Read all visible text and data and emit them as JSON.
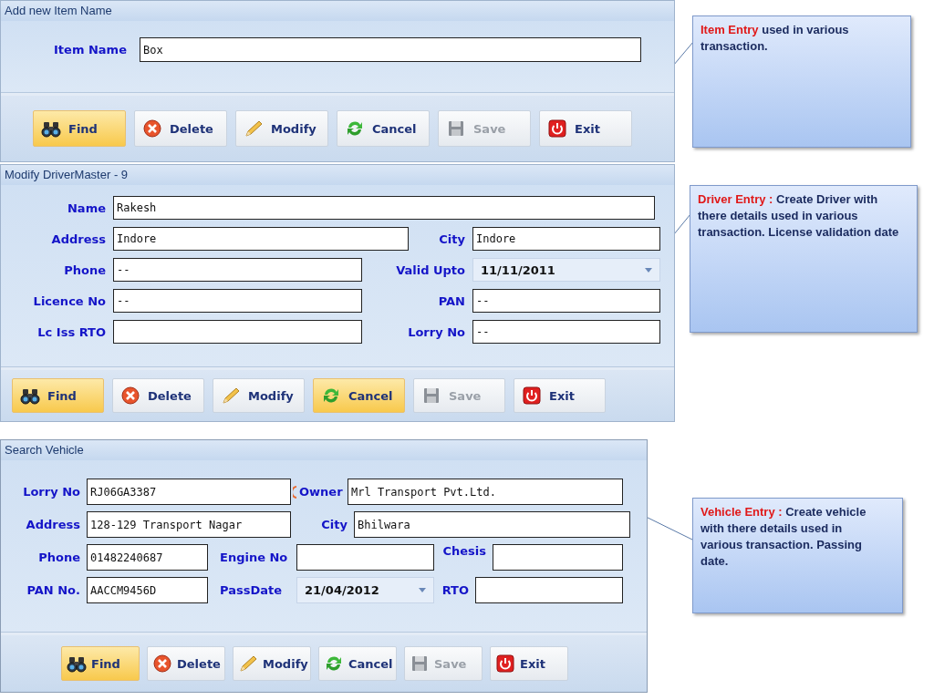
{
  "panels": [
    {
      "title": "Add new Item Name",
      "rows": [
        [
          {
            "kind": "label",
            "text": "Item Name"
          },
          {
            "kind": "text",
            "value": "Box"
          }
        ]
      ],
      "buttons": [
        {
          "kind": "find",
          "label": "Find",
          "highlighted": true,
          "disabled": false
        },
        {
          "kind": "delete",
          "label": "Delete",
          "highlighted": false,
          "disabled": false
        },
        {
          "kind": "modify",
          "label": "Modify",
          "highlighted": false,
          "disabled": false
        },
        {
          "kind": "cancel",
          "label": "Cancel",
          "highlighted": false,
          "disabled": false
        },
        {
          "kind": "save",
          "label": "Save",
          "highlighted": false,
          "disabled": true
        },
        {
          "kind": "exit",
          "label": "Exit",
          "highlighted": false,
          "disabled": false
        }
      ]
    },
    {
      "title": "Modify DriverMaster - 9",
      "rows": [
        [
          {
            "kind": "label",
            "text": "Name"
          },
          {
            "kind": "text",
            "value": "Rakesh"
          }
        ],
        [
          {
            "kind": "label",
            "text": "Address"
          },
          {
            "kind": "text",
            "value": "Indore"
          },
          {
            "kind": "label",
            "text": "City"
          },
          {
            "kind": "text",
            "value": "Indore"
          }
        ],
        [
          {
            "kind": "label",
            "text": "Phone"
          },
          {
            "kind": "text",
            "value": "--"
          },
          {
            "kind": "label",
            "text": "Valid Upto"
          },
          {
            "kind": "date",
            "value": "11/11/2011"
          }
        ],
        [
          {
            "kind": "label",
            "text": "Licence No"
          },
          {
            "kind": "text",
            "value": "--"
          },
          {
            "kind": "label",
            "text": "PAN"
          },
          {
            "kind": "text",
            "value": "--"
          }
        ],
        [
          {
            "kind": "label",
            "text": "Lc Iss RTO"
          },
          {
            "kind": "text"
          },
          {
            "kind": "label",
            "text": "Lorry No"
          },
          {
            "kind": "text",
            "value": "--"
          }
        ]
      ],
      "buttons": [
        {
          "kind": "find",
          "label": "Find",
          "highlighted": true,
          "disabled": false
        },
        {
          "kind": "delete",
          "label": "Delete",
          "highlighted": false,
          "disabled": false
        },
        {
          "kind": "modify",
          "label": "Modify",
          "highlighted": false,
          "disabled": false
        },
        {
          "kind": "cancel",
          "label": "Cancel",
          "highlighted": true,
          "disabled": false
        },
        {
          "kind": "save",
          "label": "Save",
          "highlighted": false,
          "disabled": true
        },
        {
          "kind": "exit",
          "label": "Exit",
          "highlighted": false,
          "disabled": false
        }
      ]
    },
    {
      "title": "Search Vehicle",
      "rows": [
        [
          {
            "kind": "label",
            "text": "Lorry No"
          },
          {
            "kind": "text",
            "value": "RJ06GA3387",
            "error": true
          },
          {
            "kind": "label",
            "text": "Owner"
          },
          {
            "kind": "text",
            "value": "Mrl Transport Pvt.Ltd."
          }
        ],
        [
          {
            "kind": "label",
            "text": "Address"
          },
          {
            "kind": "text",
            "value": "128-129 Transport Nagar"
          },
          {
            "kind": "label",
            "text": "City"
          },
          {
            "kind": "text",
            "value": "Bhilwara"
          }
        ],
        [
          {
            "kind": "label",
            "text": "Phone"
          },
          {
            "kind": "text",
            "value": "01482240687"
          },
          {
            "kind": "label",
            "text": "Engine No"
          },
          {
            "kind": "text"
          },
          {
            "kind": "label",
            "text": "Chesis"
          },
          {
            "kind": "text"
          }
        ],
        [
          {
            "kind": "label",
            "text": "PAN No."
          },
          {
            "kind": "text",
            "value": "AACCM9456D"
          },
          {
            "kind": "label",
            "text": "PassDate"
          },
          {
            "kind": "date",
            "value": "21/04/2012"
          },
          {
            "kind": "label",
            "text": "RTO"
          },
          {
            "kind": "text"
          }
        ]
      ],
      "buttons": [
        {
          "kind": "find",
          "label": "Find",
          "highlighted": true,
          "disabled": false
        },
        {
          "kind": "delete",
          "label": "Delete",
          "highlighted": false,
          "disabled": false
        },
        {
          "kind": "modify",
          "label": "Modify",
          "highlighted": false,
          "disabled": false
        },
        {
          "kind": "cancel",
          "label": "Cancel",
          "highlighted": false,
          "disabled": false
        },
        {
          "kind": "save",
          "label": "Save",
          "highlighted": false,
          "disabled": true
        },
        {
          "kind": "exit",
          "label": "Exit",
          "highlighted": false,
          "disabled": false
        }
      ]
    }
  ],
  "callouts": [
    {
      "highlight": "Item Entry",
      "text": " used in various transaction."
    },
    {
      "highlight": "Driver Entry :",
      "text": " Create Driver with there details used in various transaction. License validation date"
    },
    {
      "highlight": "Vehicle Entry :",
      "text": " Create vehicle with there details used in various transaction. Passing date."
    }
  ]
}
